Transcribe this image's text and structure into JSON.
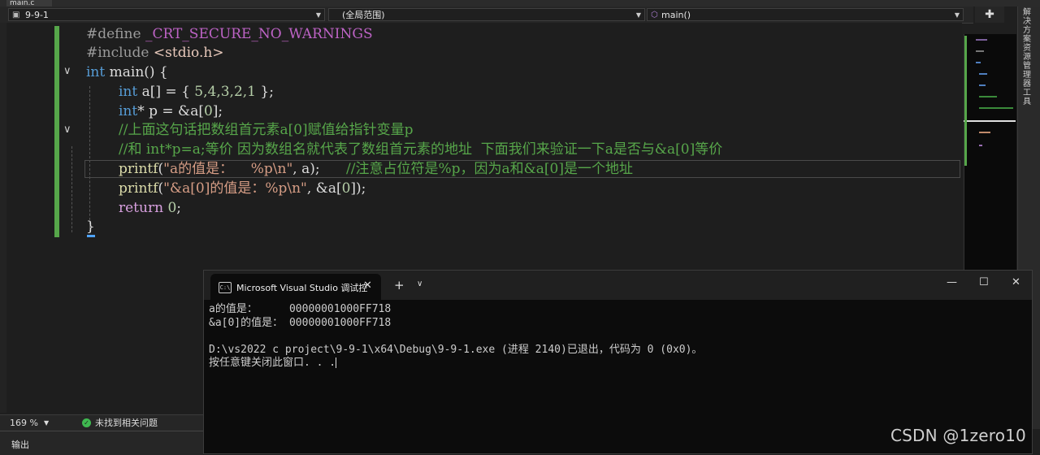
{
  "doc_tab": {
    "label": "main.c"
  },
  "nav": {
    "project": "9-9-1",
    "scope": "(全局范围)",
    "function": "main()",
    "split_icon": "split-icon"
  },
  "right_strip": {
    "label": "解决方案资源管理器 工具"
  },
  "code": {
    "l1": {
      "directive": "#define",
      "macro": "_CRT_SECURE_NO_WARNINGS"
    },
    "l2": {
      "directive": "#include",
      "header": "<stdio.h>"
    },
    "l3": {
      "type": "int",
      "rest": "main() {"
    },
    "l4": {
      "type": "int",
      "p1": "a[] = { ",
      "nums": "5,4,3,2,1",
      "p2": " };"
    },
    "l5": {
      "type": "int",
      "p1": "* p = &a[",
      "num": "0",
      "p2": "];"
    },
    "l6": {
      "comment": "//上面这句话把数组首元素a[0]赋值给指针变量p"
    },
    "l7": {
      "comment": "//和 int*p=a;等价 因为数组名就代表了数组首元素的地址  下面我们来验证一下a是否与&a[0]等价"
    },
    "l8": {
      "fn": "printf",
      "p1": "(",
      "str": "\"a的值是：    %p\\n\"",
      "p2": ", a);",
      "comment": "      //注意占位符是%p，因为a和&a[0]是一个地址"
    },
    "l9": {
      "fn": "printf",
      "p1": "(",
      "str": "\"&a[0]的值是：%p\\n\"",
      "p2": ", &a[",
      "num": "0",
      "p3": "]);"
    },
    "l10": {
      "kw": "return",
      "num": "0",
      "p1": ";"
    },
    "l11": {
      "brace": "}"
    }
  },
  "status": {
    "zoom": "169 %",
    "issues": "未找到相关问题",
    "issues_icon": "check-icon"
  },
  "output": {
    "title": "输出"
  },
  "terminal": {
    "tab_title": "Microsoft Visual Studio 调试控",
    "tab_icon": "C:\\",
    "line1": "a的值是：     00000001000FF718",
    "line2": "&a[0]的值是： 00000001000FF718",
    "line3": "",
    "line4": "D:\\vs2022 c project\\9-9-1\\x64\\Debug\\9-9-1.exe (进程 2140)已退出，代码为 0 (0x0)。",
    "line5": "按任意键关闭此窗口. . ."
  },
  "watermark": "CSDN @1zero10"
}
